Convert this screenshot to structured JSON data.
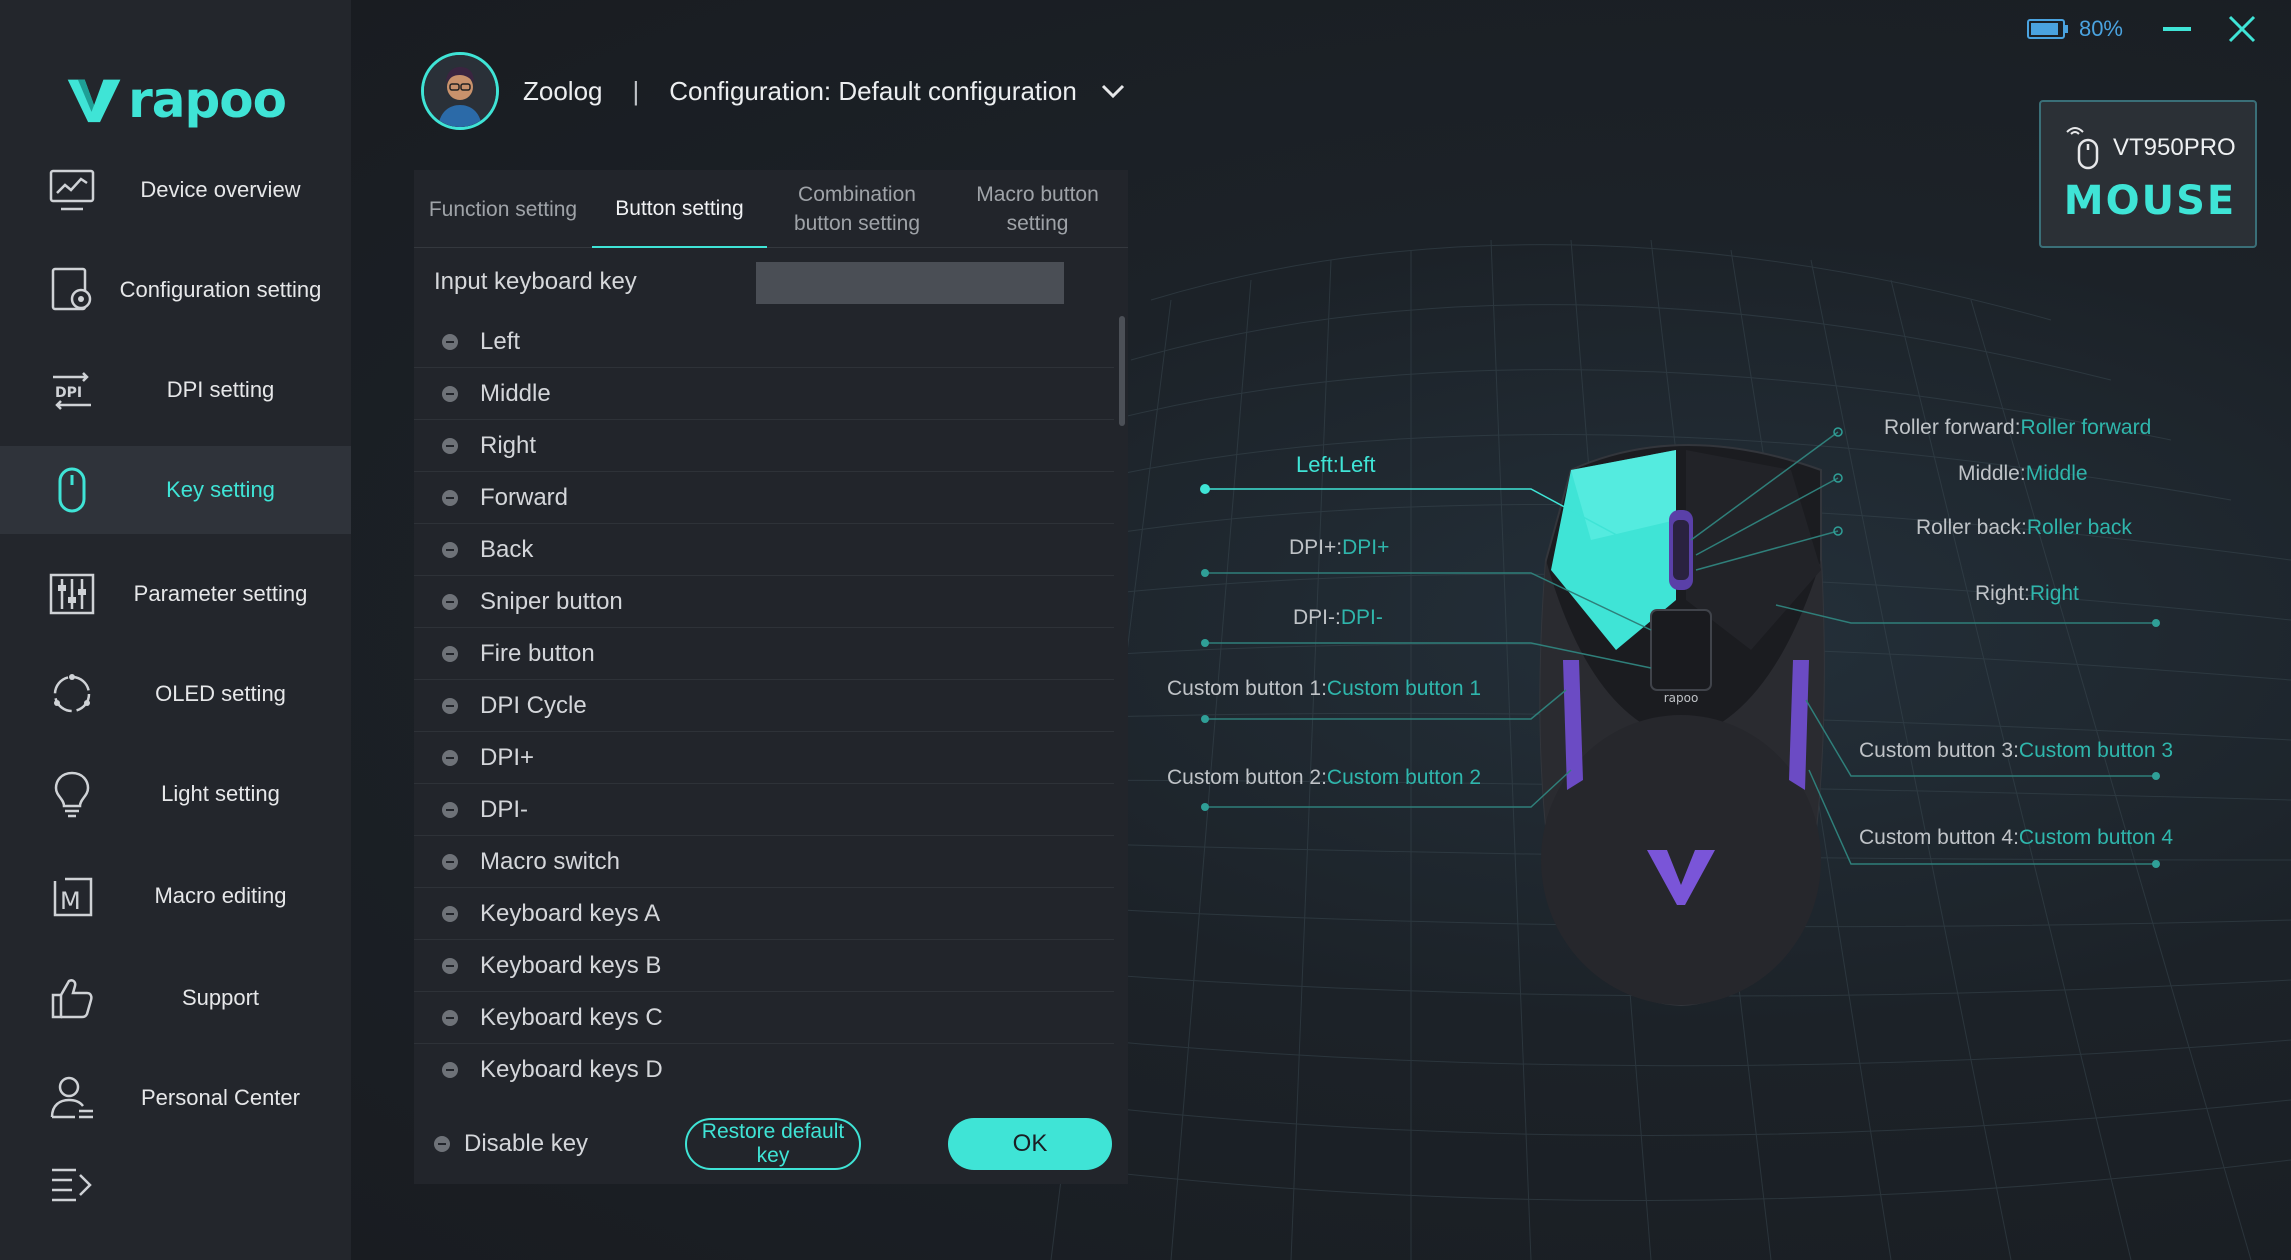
{
  "brand": {
    "logo_text": "rapoo",
    "accent": "#3fe4d6"
  },
  "sidebar": {
    "items": [
      {
        "label": "Device overview",
        "icon": "monitor-chart-icon"
      },
      {
        "label": "Configuration setting",
        "icon": "config-gear-icon"
      },
      {
        "label": "DPI setting",
        "icon": "dpi-icon"
      },
      {
        "label": "Key setting",
        "icon": "mouse-icon",
        "active": true
      },
      {
        "label": "Parameter setting",
        "icon": "sliders-icon"
      },
      {
        "label": "OLED setting",
        "icon": "cycle-icon"
      },
      {
        "label": "Light setting",
        "icon": "lightbulb-icon"
      },
      {
        "label": "Macro editing",
        "icon": "macro-icon"
      },
      {
        "label": "Support",
        "icon": "thumbs-up-icon"
      },
      {
        "label": "Personal Center",
        "icon": "user-icon"
      }
    ]
  },
  "header": {
    "username": "Zoolog",
    "separator": "|",
    "configuration": "Configuration: Default configuration"
  },
  "status": {
    "battery": "80%"
  },
  "device": {
    "name": "VT950PRO",
    "type": "MOUSE"
  },
  "tabs": [
    {
      "label": "Function setting"
    },
    {
      "label": "Button setting",
      "active": true
    },
    {
      "label": "Combination button setting"
    },
    {
      "label": "Macro button setting"
    }
  ],
  "input": {
    "label": "Input keyboard key",
    "value": ""
  },
  "keys": [
    "Left",
    "Middle",
    "Right",
    "Forward",
    "Back",
    "Sniper button",
    "Fire button",
    "DPI Cycle",
    "DPI+",
    "DPI-",
    "Macro switch",
    "Keyboard keys A",
    "Keyboard keys B",
    "Keyboard keys C",
    "Keyboard keys D"
  ],
  "footer": {
    "disable_label": "Disable key",
    "restore_label": "Restore default key",
    "ok_label": "OK"
  },
  "mapping": {
    "left": {
      "k": "Left:",
      "v": "Left"
    },
    "dpi_plus": {
      "k": "DPI+:",
      "v": "DPI+"
    },
    "dpi_minus": {
      "k": "DPI-:",
      "v": "DPI-"
    },
    "custom1": {
      "k": "Custom button 1:",
      "v": "Custom button 1"
    },
    "custom2": {
      "k": "Custom button 2:",
      "v": "Custom button 2"
    },
    "roller_forward": {
      "k": "Roller forward:",
      "v": "Roller forward"
    },
    "middle": {
      "k": "Middle:",
      "v": "Middle"
    },
    "roller_back": {
      "k": "Roller back:",
      "v": "Roller back"
    },
    "right": {
      "k": "Right:",
      "v": "Right"
    },
    "custom3": {
      "k": "Custom button 3:",
      "v": "Custom button 3"
    },
    "custom4": {
      "k": "Custom button 4:",
      "v": "Custom button 4"
    }
  }
}
